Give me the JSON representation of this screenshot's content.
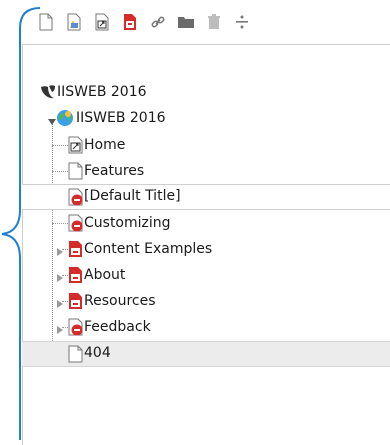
{
  "toolbar": {
    "buttons": [
      {
        "name": "new-page-icon"
      },
      {
        "name": "page-info-icon"
      },
      {
        "name": "page-shortcut-icon"
      },
      {
        "name": "page-delete-icon"
      },
      {
        "name": "link-icon"
      },
      {
        "name": "folder-icon"
      },
      {
        "name": "trash-icon"
      },
      {
        "name": "divider-icon"
      }
    ]
  },
  "tree": {
    "root": {
      "label": "IISWEB 2016",
      "icon": "typo3-logo-icon"
    },
    "site": {
      "label": "IISWEB 2016",
      "icon": "globe-icon"
    },
    "items": [
      {
        "label": "Home",
        "icon": "page-shortcut-icon"
      },
      {
        "label": "Features",
        "icon": "page-icon"
      },
      {
        "label": "[Default Title]",
        "icon": "page-restricted-icon"
      },
      {
        "label": "Customizing",
        "icon": "page-restricted-icon"
      },
      {
        "label": "Content Examples",
        "icon": "page-hidden-icon"
      },
      {
        "label": "About",
        "icon": "page-hidden-icon"
      },
      {
        "label": "Resources",
        "icon": "page-hidden-icon"
      },
      {
        "label": "Feedback",
        "icon": "page-restricted-icon"
      },
      {
        "label": "404",
        "icon": "page-icon"
      }
    ]
  }
}
